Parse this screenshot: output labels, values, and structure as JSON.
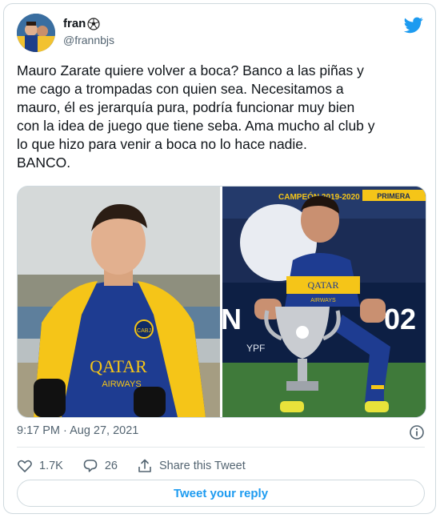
{
  "colors": {
    "accent": "#1d9bf0",
    "muted": "#536471",
    "text": "#0f1419",
    "border": "#cfd9de"
  },
  "author": {
    "name": "fran",
    "name_emoji": "soccer-ball-icon",
    "handle": "@frannbjs"
  },
  "tweet": {
    "text": "Mauro Zarate quiere volver a boca? Banco a las piñas y\nme cago a trompadas con quien sea. Necesitamos a\nmauro, él es jerarquía pura, podría funcionar muy bien\ncon la idea de juego que tiene seba. Ama mucho al club y\nlo que hizo para venir a boca no lo hace nadie.\nBANCO.",
    "timestamp": "9:17 PM · Aug 27, 2021"
  },
  "media": {
    "photo1": {
      "shirt_logo": "QATAR",
      "shirt_logo_sub": "AIRWAYS",
      "crest": "CABJ"
    },
    "photo2": {
      "banner_text": "CAMPEÓN 2019-2020",
      "board_left": "N",
      "board_right": "02",
      "shirt_logo": "QATAR",
      "shirt_logo_sub": "AIRWAYS",
      "banner_right": "PRIMERA",
      "sign_right": "YPF"
    }
  },
  "stats": {
    "likes": "1.7K",
    "replies": "26",
    "share_label": "Share this Tweet"
  },
  "reply_button": {
    "label": "Tweet your reply"
  }
}
